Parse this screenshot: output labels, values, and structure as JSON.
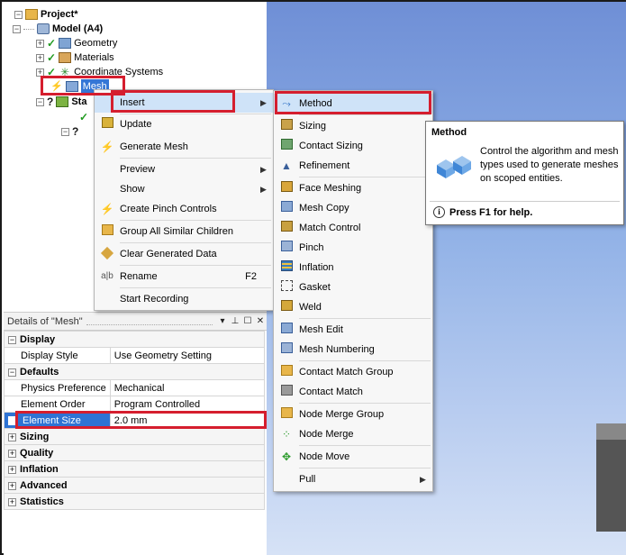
{
  "tree": {
    "project": "Project*",
    "model": "Model (A4)",
    "geometry": "Geometry",
    "materials": "Materials",
    "coordinate_systems": "Coordinate Systems",
    "mesh": "Mesh",
    "static_partial": "Sta"
  },
  "context_menu": {
    "items": [
      {
        "label": "Insert",
        "icon": "none",
        "submenu": true
      },
      {
        "label": "Update",
        "icon": "update-icon"
      },
      {
        "label": "Generate Mesh",
        "icon": "lightning-icon"
      },
      {
        "label": "Preview",
        "icon": "none",
        "submenu": true
      },
      {
        "label": "Show",
        "icon": "none",
        "submenu": true
      },
      {
        "label": "Create Pinch Controls",
        "icon": "lightning-icon"
      },
      {
        "label": "Group All Similar Children",
        "icon": "folder-icon"
      },
      {
        "label": "Clear Generated Data",
        "icon": "eraser-icon"
      },
      {
        "label": "Rename",
        "icon": "rename-icon",
        "shortcut": "F2"
      },
      {
        "label": "Start Recording",
        "icon": "none"
      }
    ]
  },
  "insert_submenu": {
    "items": [
      {
        "label": "Method",
        "icon": "method-icon"
      },
      {
        "label": "Sizing",
        "icon": "sizing-icon"
      },
      {
        "label": "Contact Sizing",
        "icon": "contact-sizing-icon"
      },
      {
        "label": "Refinement",
        "icon": "refinement-icon"
      },
      {
        "label": "Face Meshing",
        "icon": "face-meshing-icon"
      },
      {
        "label": "Mesh Copy",
        "icon": "mesh-copy-icon"
      },
      {
        "label": "Match Control",
        "icon": "match-control-icon"
      },
      {
        "label": "Pinch",
        "icon": "pinch-icon"
      },
      {
        "label": "Inflation",
        "icon": "inflation-icon"
      },
      {
        "label": "Gasket",
        "icon": "gasket-icon"
      },
      {
        "label": "Weld",
        "icon": "weld-icon"
      },
      {
        "label": "Mesh Edit",
        "icon": "mesh-edit-icon"
      },
      {
        "label": "Mesh Numbering",
        "icon": "mesh-numbering-icon"
      },
      {
        "label": "Contact Match Group",
        "icon": "contact-match-group-icon"
      },
      {
        "label": "Contact Match",
        "icon": "contact-match-icon"
      },
      {
        "label": "Node Merge Group",
        "icon": "node-merge-group-icon"
      },
      {
        "label": "Node Merge",
        "icon": "node-merge-icon"
      },
      {
        "label": "Node Move",
        "icon": "node-move-icon"
      },
      {
        "label": "Pull",
        "icon": "none",
        "submenu": true
      }
    ]
  },
  "tooltip": {
    "title": "Method",
    "description": "Control the algorithm and mesh types used to generate meshes on scoped entities.",
    "help": "Press F1 for help."
  },
  "details": {
    "title": "Details of \"Mesh\"",
    "groups": {
      "display": "Display",
      "defaults": "Defaults",
      "sizing": "Sizing",
      "quality": "Quality",
      "inflation": "Inflation",
      "advanced": "Advanced",
      "statistics": "Statistics"
    },
    "rows": {
      "display_style": {
        "name": "Display Style",
        "value": "Use Geometry Setting"
      },
      "physics_preference": {
        "name": "Physics Preference",
        "value": "Mechanical"
      },
      "element_order": {
        "name": "Element Order",
        "value": "Program Controlled"
      },
      "element_size": {
        "name": "Element Size",
        "value": "2.0 mm"
      }
    }
  },
  "colors": {
    "highlight_box": "#d51e2e",
    "selection": "#2e73d4",
    "menu_hover": "#cfe3f8"
  }
}
